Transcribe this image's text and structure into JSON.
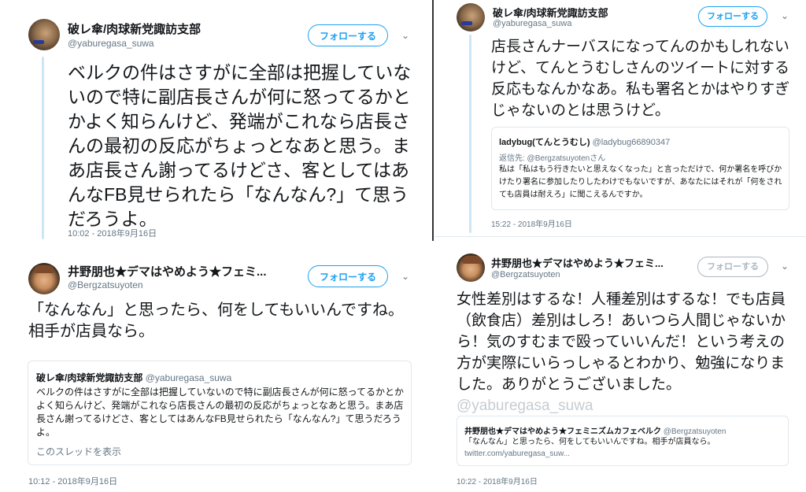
{
  "follow_label": "フォローする",
  "tweet1": {
    "author_name": "破レ傘/肉球新党諏訪支部",
    "author_handle": "@yaburegasa_suwa",
    "text": "ベルクの件はさすがに全部は把握していないので特に副店長さんが何に怒ってるかとかよく知らんけど、発端がこれなら店長さんの最初の反応がちょっとなあと思う。まあ店長さん謝ってるけどさ、客としてはあんなFB見せられたら「なんなん?」て思うだろうよ。",
    "timestamp": "10:02 - 2018年9月16日"
  },
  "tweet2": {
    "author_name": "破レ傘/肉球新党諏訪支部",
    "author_handle": "@yaburegasa_suwa",
    "text": "店長さんナーバスになってんのかもしれないけど、てんとうむしさんのツイートに対する反応もなんかなあ。私も署名とかはやりすぎじゃないのとは思うけど。",
    "quote": {
      "author_name": "ladybug(てんとうむし)",
      "author_handle": "@ladybug66890347",
      "reply_to": "返信先: @Bergzatsuyotenさん",
      "text": "私は「私はもう行きたいと思えなくなった」と言っただけで、何か署名を呼びかけたり署名に参加したりしたわけでもないですが、あなたにはそれが「何をされても店員は耐えろ」に聞こえるんですか。"
    },
    "timestamp": "15:22 - 2018年9月16日"
  },
  "tweet3": {
    "author_name": "井野朋也★デマはやめよう★フェミ...",
    "author_handle": "@Bergzatsuyoten",
    "text": "「なんなん」と思ったら、何をしてもいいんですね。相手が店員なら。",
    "quote": {
      "author_name": "破レ傘/肉球新党諏訪支部",
      "author_handle": "@yaburegasa_suwa",
      "text": "ベルクの件はさすがに全部は把握していないので特に副店長さんが何に怒ってるかとかよく知らんけど、発端がこれなら店長さんの最初の反応がちょっとなあと思う。まあ店長さん謝ってるけどさ、客としてはあんなFB見せられたら「なんなん?」て思うだろうよ。",
      "thread_link": "このスレッドを表示"
    },
    "timestamp": "10:12 - 2018年9月16日"
  },
  "tweet4": {
    "author_name": "井野朋也★デマはやめよう★フェミ...",
    "author_handle": "@Bergzatsuyoten",
    "text": "女性差別はするな！人種差別はするな！でも店員（飲食店）差別はしろ！あいつら人間じゃないから！気のすむまで殴っていいんだ！という考えの方が実際にいらっしゃるとわかり、勉強になりました。ありがとうございました。",
    "watermark": "@yaburegasa_suwa",
    "quote": {
      "author_name": "井野朋也★デマはやめよう★フェミニズムカフェベルク",
      "author_handle": "@Bergzatsuyoten",
      "text": "「なんなん」と思ったら、何をしてもいいんですね。相手が店員なら。",
      "link": "twitter.com/yaburegasa_suw..."
    },
    "timestamp": "10:22 - 2018年9月16日"
  }
}
